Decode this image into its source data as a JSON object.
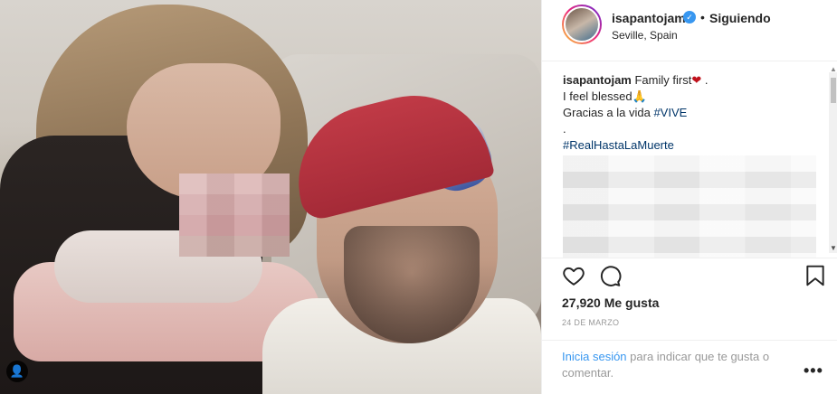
{
  "post": {
    "header": {
      "username": "isapantojam",
      "verified_mark": "✓",
      "separator": "•",
      "follow_status": "Siguiendo",
      "location": "Seville, Spain"
    },
    "caption": {
      "username": "isapantojam",
      "line1_text": "Family first",
      "line1_emoji": "❤",
      "line1_tail": " .",
      "line2_text": "I feel blessed",
      "line2_emoji": "🙏",
      "line3_text": "Gracias a la vida ",
      "line3_hashtag": "#VIVE",
      "line4_text": ".",
      "line5_hashtag": "#RealHastaLaMuerte"
    },
    "stats": {
      "likes": "27,920 Me gusta",
      "date": "24 DE MARZO"
    },
    "footer": {
      "login_link": "Inicia sesión",
      "login_text": " para indicar que te gusta o comentar.",
      "more_icon": "•••"
    },
    "photo": {
      "user_tag_icon": "👤"
    }
  },
  "icons": [
    "heart-outline-icon",
    "comment-bubble-icon",
    "bookmark-icon",
    "more-options-icon",
    "verified-badge-icon",
    "user-tag-icon"
  ],
  "colors": {
    "link": "#3897f0",
    "hashtag": "#003569",
    "verified": "#3897f0",
    "text": "#262626",
    "muted": "#999999"
  }
}
